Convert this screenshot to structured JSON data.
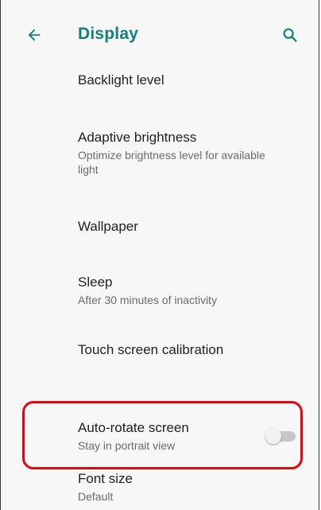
{
  "header": {
    "title": "Display",
    "back_icon": "arrow-back-icon",
    "search_icon": "search-icon",
    "accent_color": "#12807b"
  },
  "settings": [
    {
      "title": "Backlight level",
      "summary": ""
    },
    {
      "title": "Adaptive brightness",
      "summary": "Optimize brightness level for available light"
    },
    {
      "title": "Wallpaper",
      "summary": ""
    },
    {
      "title": "Sleep",
      "summary": "After 30 minutes of inactivity"
    },
    {
      "title": "Touch screen calibration",
      "summary": ""
    },
    {
      "title": "Auto-rotate screen",
      "summary": "Stay in portrait view",
      "toggle": "off"
    },
    {
      "title": "Font size",
      "summary": "Default"
    }
  ],
  "highlight_color": "#e30613"
}
